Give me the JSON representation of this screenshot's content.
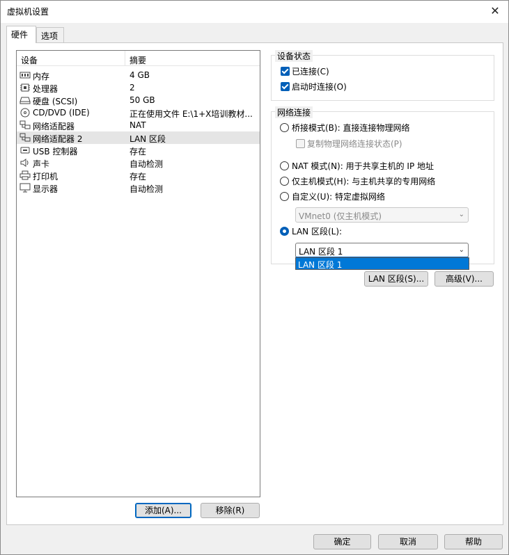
{
  "window": {
    "title": "虚拟机设置"
  },
  "tabs": [
    {
      "label": "硬件"
    },
    {
      "label": "选项"
    }
  ],
  "device_list": {
    "headers": {
      "device": "设备",
      "summary": "摘要"
    },
    "rows": [
      {
        "icon": "memory-icon",
        "name": "内存",
        "summary": "4 GB"
      },
      {
        "icon": "cpu-icon",
        "name": "处理器",
        "summary": "2"
      },
      {
        "icon": "hard-disk-icon",
        "name": "硬盘 (SCSI)",
        "summary": "50 GB"
      },
      {
        "icon": "cd-dvd-icon",
        "name": "CD/DVD (IDE)",
        "summary": "正在使用文件 E:\\1+X培训教材..."
      },
      {
        "icon": "network-adapter-icon",
        "name": "网络适配器",
        "summary": "NAT"
      },
      {
        "icon": "network-adapter-icon",
        "name": "网络适配器 2",
        "summary": "LAN 区段",
        "selected": true
      },
      {
        "icon": "usb-controller-icon",
        "name": "USB 控制器",
        "summary": "存在"
      },
      {
        "icon": "sound-card-icon",
        "name": "声卡",
        "summary": "自动检测"
      },
      {
        "icon": "printer-icon",
        "name": "打印机",
        "summary": "存在"
      },
      {
        "icon": "display-icon",
        "name": "显示器",
        "summary": "自动检测"
      }
    ]
  },
  "list_buttons": {
    "add": "添加(A)...",
    "remove": "移除(R)"
  },
  "device_status": {
    "title": "设备状态",
    "connected": {
      "label": "已连接(C)",
      "checked": true
    },
    "connect_at_power_on": {
      "label": "启动时连接(O)",
      "checked": true
    }
  },
  "network": {
    "title": "网络连接",
    "bridged": "桥接模式(B): 直接连接物理网络",
    "replicate": "复制物理网络连接状态(P)",
    "nat": "NAT 模式(N): 用于共享主机的 IP 地址",
    "host_only": "仅主机模式(H): 与主机共享的专用网络",
    "custom": "自定义(U): 特定虚拟网络",
    "custom_select": "VMnet0 (仅主机模式)",
    "lan_segment": "LAN 区段(L):",
    "lan_select": "LAN 区段 1",
    "lan_option": "LAN 区段 1",
    "selected_mode": "lan_segment"
  },
  "network_buttons": {
    "lan_segments": "LAN 区段(S)...",
    "advanced": "高级(V)..."
  },
  "footer": {
    "ok": "确定",
    "cancel": "取消",
    "help": "帮助"
  },
  "colors": {
    "accent": "#005fb8",
    "selection": "#0078d7"
  }
}
